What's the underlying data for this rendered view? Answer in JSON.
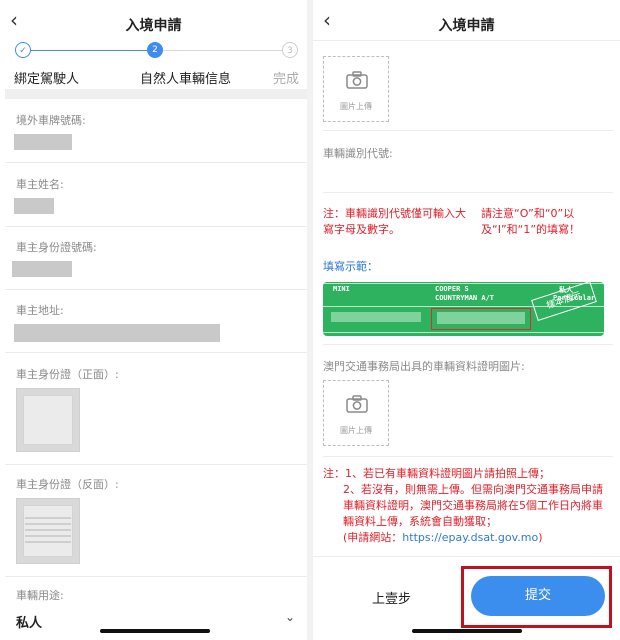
{
  "left": {
    "title": "入境申請",
    "back_icon": "chevron-left-icon",
    "stepper": {
      "steps": [
        {
          "number": "",
          "label": "綁定駕駛人",
          "state": "done"
        },
        {
          "number": "2",
          "label": "自然人車輛信息",
          "state": "current"
        },
        {
          "number": "3",
          "label": "完成",
          "state": "pending"
        }
      ],
      "accent": "#3f8cf0"
    },
    "fields": {
      "plate": "境外車牌號碼:",
      "owner_name": "車主姓名:",
      "owner_id_no": "車主身份證號碼:",
      "owner_address": "車主地址:",
      "id_front": "車主身份證（正面）:",
      "id_back": "車主身份證（反面）:",
      "usage": "車輛用途:"
    },
    "usage_value": "私人",
    "dropdown_icon": "chevron-down-icon"
  },
  "right": {
    "title": "入境申請",
    "back_icon": "chevron-left-icon",
    "upload_label": "圖片上傳",
    "upload_icon": "camera-icon",
    "vin_label": "車輛識別代號:",
    "note1_left": "注：車輛識別代號僅可輸入大寫字母及數字。",
    "note1_right": "請注意“O”和“0”以及“I”和“1”的填寫！",
    "example_label": "填寫示範：",
    "sample": {
      "text_mini": "MINI",
      "text_cooper": "COOPER S",
      "text_countryman": "COUNTRYMAN A/T",
      "text_private": "私人",
      "text_particular": "Particular",
      "stamp": "樣本展示"
    },
    "cert_label": "澳門交通事務局出具的車輛資料證明圖片:",
    "note2": {
      "line1": "注：1、若已有車輛資料證明圖片請拍照上傳；",
      "line2": "2、若沒有，則無需上傳。但需向澳門交通事務局申請",
      "line3": "車輛資料證明，澳門交通事務局將在5個工作日內將車",
      "line4": "輛資料上傳，系統會自動獲取；",
      "line5_prefix": "(申請網站：",
      "line5_link": "https://epay.dsat.gov.mo",
      "line5_suffix": ")"
    },
    "prev_label": "上壹步",
    "submit_label": "提交",
    "accent": "#3b8eed",
    "highlight": "#c0121d"
  }
}
